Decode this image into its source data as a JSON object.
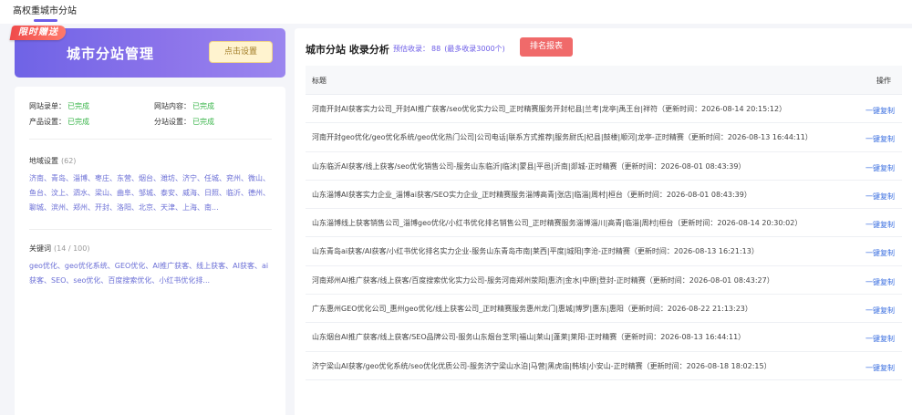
{
  "top": {
    "tab": "高权重城市分站"
  },
  "banner": {
    "ribbon": "限时赠送",
    "title": "城市分站管理",
    "button": "点击设置"
  },
  "status": [
    {
      "label": "网站录单：",
      "value": "已完成"
    },
    {
      "label": "网站内容：",
      "value": "已完成"
    },
    {
      "label": "产品设置：",
      "value": "已完成"
    },
    {
      "label": "分站设置：",
      "value": "已完成"
    }
  ],
  "region": {
    "label": "地域设置",
    "count": "(62)",
    "text": "济南、青岛、淄博、枣庄、东营、烟台、潍坊、济宁、任城、兖州、微山、鱼台、汶上、泗水、梁山、曲阜、邹城、泰安、威海、日照、临沂、德州、聊城、滨州、郑州、开封、洛阳、北京、天津、上海、南..."
  },
  "keywords": {
    "label": "关键词",
    "count": "(14 / 100)",
    "text": "geo优化、geo优化系统、GEO优化、AI推广获客、线上获客、AI获客、ai获客、SEO、seo优化、百度搜索优化、小红书优化排..."
  },
  "right": {
    "title": "城市分站 收录分析",
    "stat_label": "预估收录：",
    "stat_value": "88",
    "stat_max": "(最多收录3000个)",
    "rank_button": "排名报表",
    "col_title": "标题",
    "col_op": "操作",
    "op_label": "一键复制",
    "rows": [
      "河南开封AI获客实力公司_开封AI推广获客/seo优化实力公司_正时精赛服务开封杞县|兰考|龙亭|禹王台|祥符（更新时间：2026-08-14 20:15:12）",
      "河南开封geo优化/geo优化系统/geo优化热门公司|公司电话|联系方式推荐|服务尉氏|杞县|鼓楼|顺河|龙亭-正时精赛（更新时间：2026-08-13 16:44:11）",
      "山东临沂AI获客/线上获客/seo优化销售公司-服务山东临沂|临沭|蒙县|平邑|沂南|郯城-正时精赛（更新时间：2026-08-01 08:43:39）",
      "山东淄博AI获客实力企业_淄博ai获客/SEO实力企业_正时精赛服务淄博高青|张店|临淄|周村|桓台（更新时间：2026-08-01 08:43:39）",
      "山东淄博线上获客销售公司_淄博geo优化/小红书优化排名销售公司_正时精赛服务淄博淄川|高青|临淄|周村|桓台（更新时间：2026-08-14 20:30:02）",
      "山东青岛ai获客/AI获客/小红书优化排名实力企业-服务山东青岛市南|莱西|平度|城阳|李沧-正时精赛（更新时间：2026-08-13 16:21:13）",
      "河南郑州AI推广获客/线上获客/百度搜索优化实力公司-服务河南郑州荥阳|惠济|金水|中原|登封-正时精赛（更新时间：2026-08-01 08:43:27）",
      "广东惠州GEO优化公司_惠州geo优化/线上获客公司_正时精赛服务惠州龙门|惠城|博罗|惠东|惠阳（更新时间：2026-08-22 21:13:23）",
      "山东烟台AI推广获客/线上获客/SEO品牌公司-服务山东烟台芝罘|福山|莱山|蓬莱|莱阳-正时精赛（更新时间：2026-08-13 16:44:11）",
      "济宁梁山AI获客/geo优化系统/seo优化优质公司-服务济宁梁山水泊|马营|黑虎庙|韩垓|小安山-正时精赛（更新时间：2026-08-18 18:02:15）"
    ]
  }
}
